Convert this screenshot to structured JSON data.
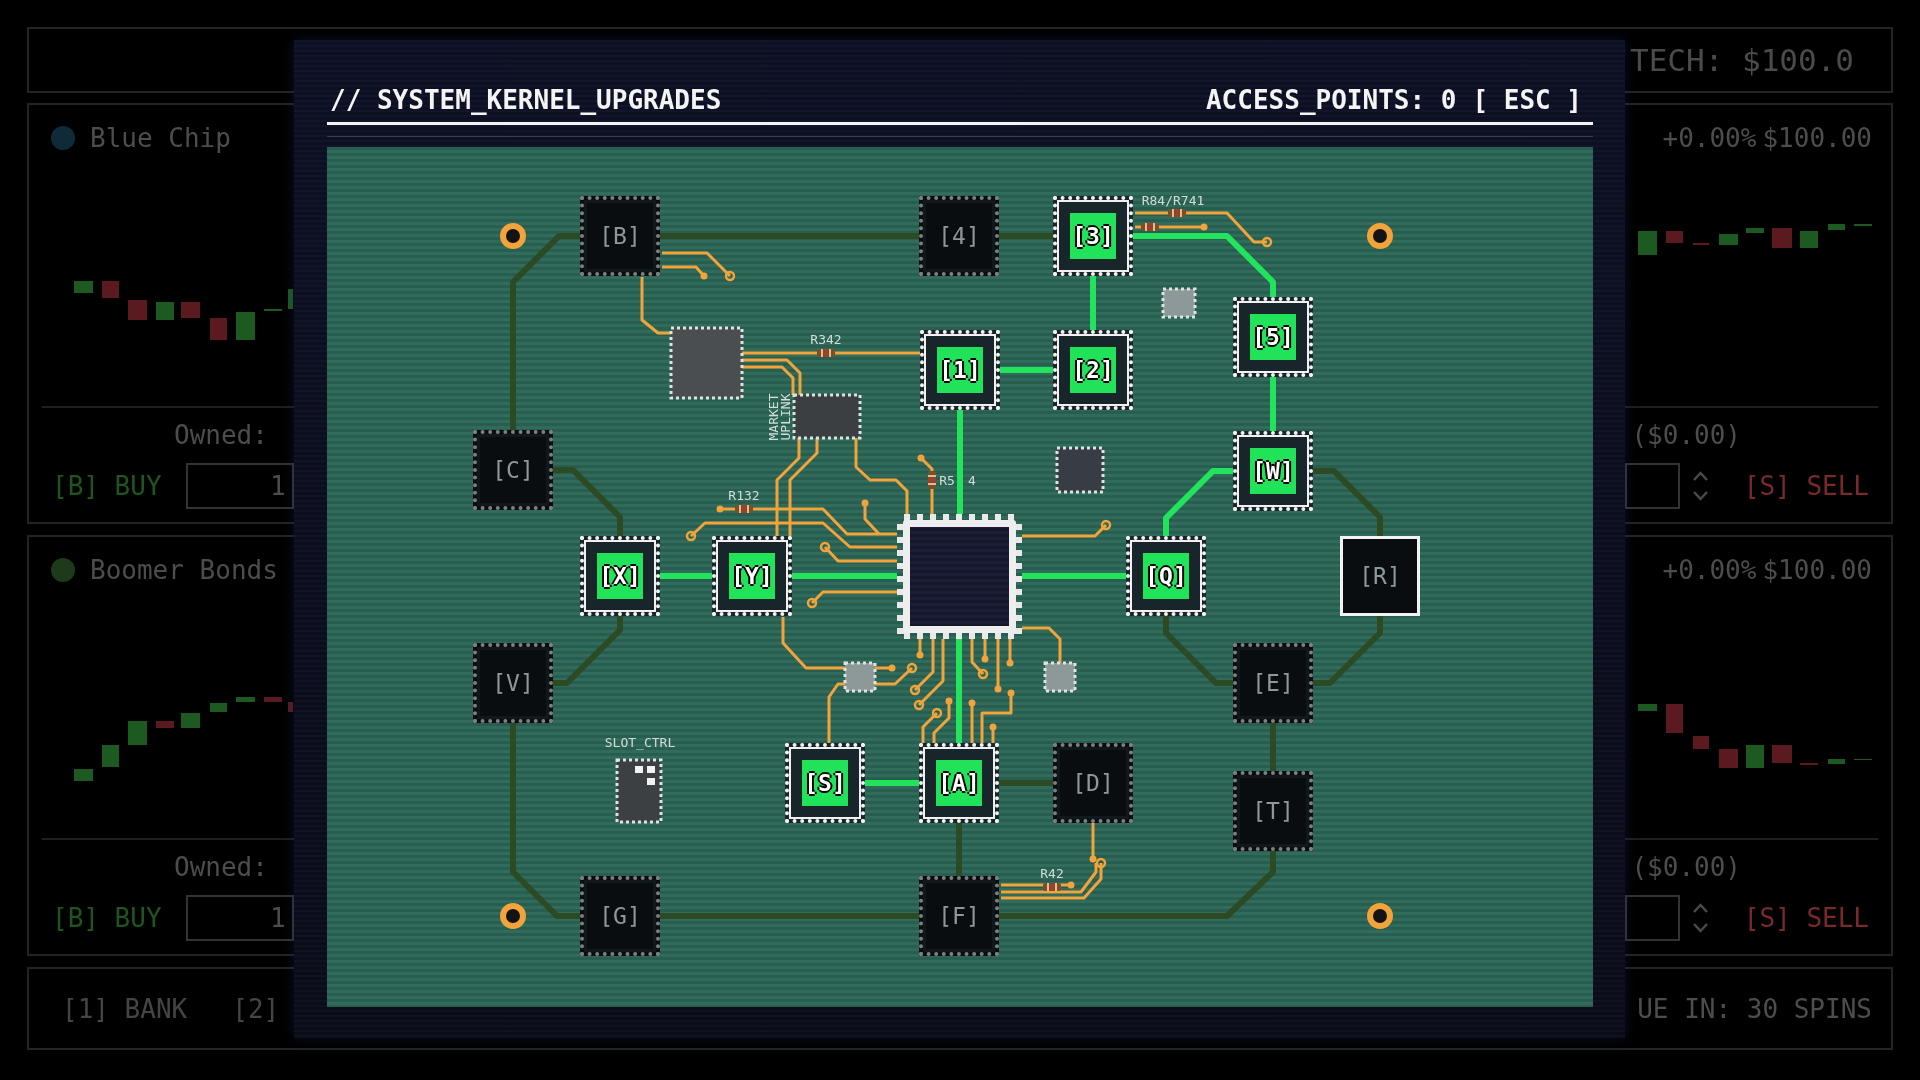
{
  "background": {
    "top_bar": {
      "ticker": "TECH: $100.0"
    },
    "cards": [
      {
        "name": "Blue Chip",
        "color": "#0f2b39",
        "change": "+0.00%",
        "price": "$100.00",
        "owned": "Owned:",
        "holding_value": "($0.00)",
        "buy_button": "[B] BUY",
        "quantity": "1",
        "sell_button": "[S] SELL"
      },
      {
        "name": "Boomer Bonds",
        "color": "#1d3a1b",
        "change": "+0.00%",
        "price": "$100.00",
        "owned": "Owned:",
        "holding_value": "($0.00)",
        "buy_button": "[B] BUY",
        "quantity": "1",
        "sell_button": "[S] SELL"
      }
    ],
    "bottom_bar": {
      "nav_buttons": [
        "[1] BANK",
        "[2]"
      ],
      "notice": "UE IN: 30 SPINS"
    }
  },
  "modal": {
    "title": "// SYSTEM_KERNEL_UPGRADES",
    "access_points": "ACCESS_POINTS: 0",
    "close_button": "[ ESC ]",
    "nodes": [
      {
        "label": "[B]",
        "owned": false,
        "locked": true
      },
      {
        "label": "[4]",
        "owned": false,
        "locked": true
      },
      {
        "label": "[3]",
        "owned": true,
        "locked": false
      },
      {
        "label": "[5]",
        "owned": true,
        "locked": false
      },
      {
        "label": "[1]",
        "owned": true,
        "locked": false
      },
      {
        "label": "[2]",
        "owned": true,
        "locked": false
      },
      {
        "label": "[C]",
        "owned": false,
        "locked": true
      },
      {
        "label": "[W]",
        "owned": true,
        "locked": false
      },
      {
        "label": "[X]",
        "owned": true,
        "locked": false
      },
      {
        "label": "[Y]",
        "owned": true,
        "locked": false
      },
      {
        "label": "[Q]",
        "owned": true,
        "locked": false
      },
      {
        "label": "[R]",
        "owned": false,
        "locked": false
      },
      {
        "label": "[V]",
        "owned": false,
        "locked": true
      },
      {
        "label": "[E]",
        "owned": false,
        "locked": true
      },
      {
        "label": "[S]",
        "owned": true,
        "locked": false
      },
      {
        "label": "[A]",
        "owned": true,
        "locked": false
      },
      {
        "label": "[D]",
        "owned": false,
        "locked": true
      },
      {
        "label": "[T]",
        "owned": false,
        "locked": true
      },
      {
        "label": "[G]",
        "owned": false,
        "locked": true
      },
      {
        "label": "[F]",
        "owned": false,
        "locked": true
      }
    ],
    "silkscreen": [
      {
        "text": "R342",
        "kind": "flat"
      },
      {
        "text": "R132",
        "kind": "flat"
      },
      {
        "text": "R5",
        "kind": "flat"
      },
      {
        "text": "4",
        "kind": "flat"
      },
      {
        "text": "R84/R741",
        "kind": "flat"
      },
      {
        "text": "R42",
        "kind": "flat"
      },
      {
        "text": "MARKET UPLINK",
        "kind": "vertical"
      },
      {
        "text": "SLOT_CTRL",
        "kind": "flat"
      }
    ]
  }
}
